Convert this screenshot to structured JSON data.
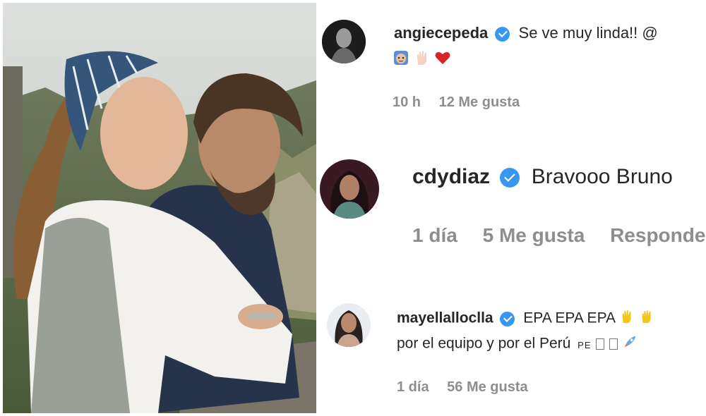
{
  "photo": {
    "description_icon": "photo-couple-machu-picchu"
  },
  "comments": [
    {
      "username": "angiecepeda",
      "verified": true,
      "text": "Se ve muy linda!! @",
      "emoji_line": [
        "monkey-face",
        "raised-hand",
        "red-heart"
      ],
      "time": "10 h",
      "likes": "12 Me gusta",
      "reply": ""
    },
    {
      "username": "cdydiaz",
      "verified": true,
      "text": "Bravooo Bruno",
      "time": "1 día",
      "likes": "5 Me gusta",
      "reply": "Responde"
    },
    {
      "username": "mayellalloclla",
      "verified": true,
      "text": "EPA EPA EPA",
      "text_line2": "por el equipo y por el Perú",
      "flag_text": "PE",
      "time": "1 día",
      "likes": "56 Me gusta",
      "reply": ""
    }
  ],
  "colors": {
    "verified": "#3897f0",
    "muted": "#8e8e8e",
    "text": "#262626",
    "heart": "#d8232a"
  }
}
